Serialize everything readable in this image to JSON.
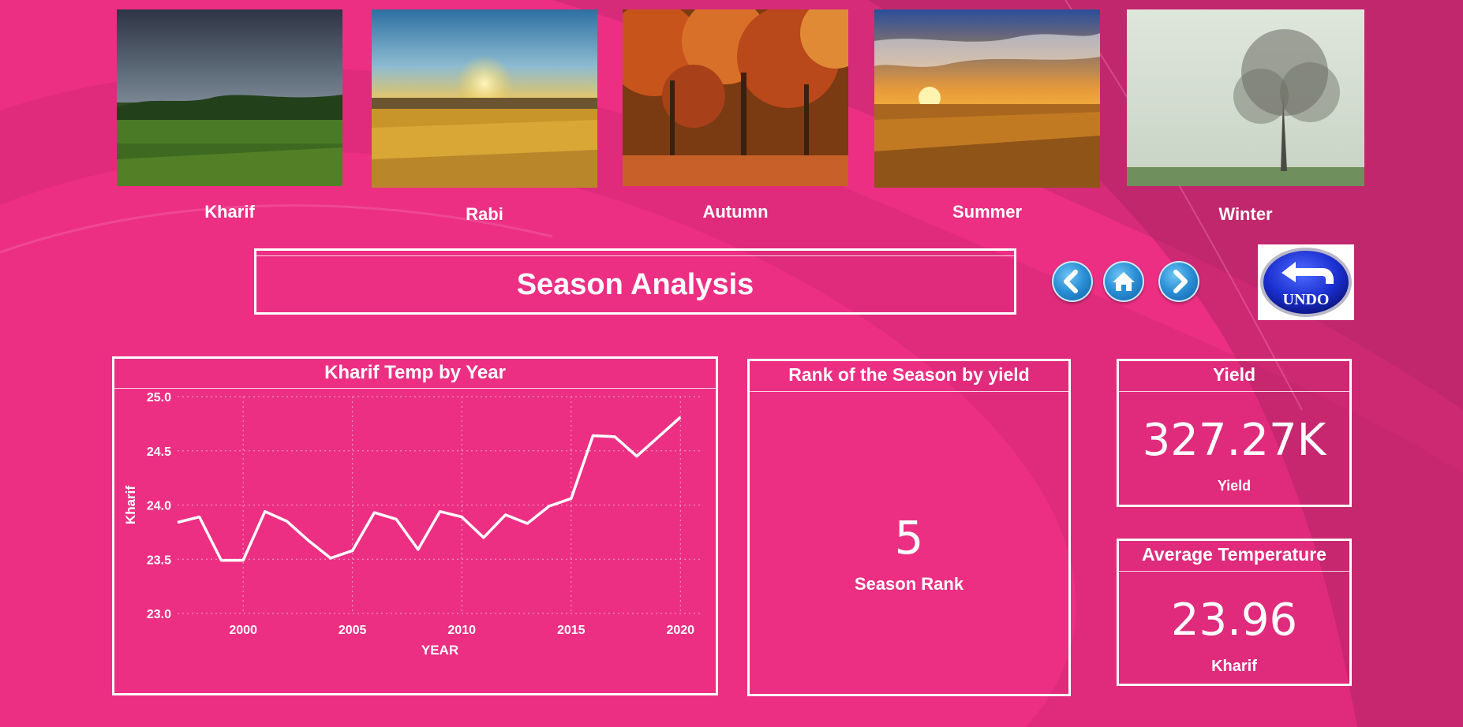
{
  "seasons": [
    {
      "label": "Kharif",
      "image": "monsoon-green-field-photo"
    },
    {
      "label": "Rabi",
      "image": "golden-wheat-sunrise-photo"
    },
    {
      "label": "Autumn",
      "image": "orange-autumn-trees-photo"
    },
    {
      "label": "Summer",
      "image": "sunset-farm-field-photo"
    },
    {
      "label": "Winter",
      "image": "foggy-bare-tree-photo"
    }
  ],
  "header": {
    "title": "Season Analysis"
  },
  "nav": {
    "back": "chevron-left-icon",
    "home": "home-icon",
    "forward": "chevron-right-icon",
    "undo_label": "UNDO"
  },
  "chart_panel": {
    "title": "Kharif Temp by Year"
  },
  "chart_data": {
    "type": "line",
    "title": "Kharif Temp by Year",
    "xlabel": "YEAR",
    "ylabel": "Kharif",
    "xlim": [
      1997,
      2021
    ],
    "ylim": [
      23.0,
      25.0
    ],
    "xticks": [
      2000,
      2005,
      2010,
      2015,
      2020
    ],
    "yticks": [
      23.0,
      23.5,
      24.0,
      24.5,
      25.0
    ],
    "grid": true,
    "x": [
      1997,
      1998,
      1999,
      2000,
      2001,
      2002,
      2003,
      2004,
      2005,
      2006,
      2007,
      2008,
      2009,
      2010,
      2011,
      2012,
      2013,
      2014,
      2015,
      2016,
      2017,
      2018,
      2019,
      2020
    ],
    "y": [
      23.84,
      23.89,
      23.49,
      23.49,
      23.94,
      23.85,
      23.67,
      23.51,
      23.58,
      23.93,
      23.87,
      23.59,
      23.94,
      23.89,
      23.7,
      23.91,
      23.83,
      23.99,
      24.06,
      24.64,
      24.63,
      24.45,
      24.63,
      24.81
    ]
  },
  "rank_panel": {
    "title": "Rank of the Season by yield",
    "value": "5",
    "label": "Season Rank"
  },
  "yield_panel": {
    "title": "Yield",
    "value": "327.27K",
    "label": "Yield"
  },
  "temp_panel": {
    "title": "Average Temperature",
    "value": "23.96",
    "label": "Kharif"
  },
  "colors": {
    "background": "#e82d7f",
    "panel_border": "#ffffff",
    "line": "#ffffff"
  }
}
